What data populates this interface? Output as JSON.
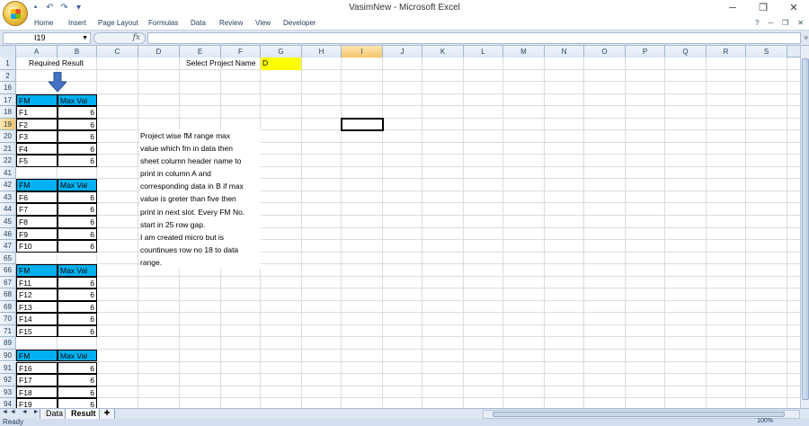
{
  "window": {
    "title": "VasimNew - Microsoft Excel"
  },
  "ribbon": {
    "tabs": [
      "Home",
      "Insert",
      "Page Layout",
      "Formulas",
      "Data",
      "Review",
      "View",
      "Developer"
    ]
  },
  "formula_bar": {
    "name_box": "I19",
    "fx": "fx",
    "content": ""
  },
  "columns": [
    "A",
    "B",
    "C",
    "D",
    "E",
    "F",
    "G",
    "H",
    "I",
    "J",
    "K",
    "L",
    "M",
    "N",
    "O",
    "P",
    "Q",
    "R",
    "S"
  ],
  "selected_column": "I",
  "rows": [
    "1",
    "2",
    "16",
    "17",
    "18",
    "19",
    "20",
    "21",
    "22",
    "41",
    "42",
    "43",
    "44",
    "45",
    "46",
    "47",
    "65",
    "66",
    "67",
    "68",
    "69",
    "70",
    "71",
    "89",
    "90",
    "91",
    "92",
    "93",
    "94"
  ],
  "selected_row": "19",
  "cells": {
    "a1": "Required Result",
    "e1": "Select Project Name",
    "g1": "D"
  },
  "tables": [
    {
      "header": [
        "FM",
        "Max Val"
      ],
      "rows": [
        [
          "F1",
          "6"
        ],
        [
          "F2",
          "6"
        ],
        [
          "F3",
          "6"
        ],
        [
          "F4",
          "6"
        ],
        [
          "F5",
          "6"
        ]
      ]
    },
    {
      "header": [
        "FM",
        "Max Val"
      ],
      "rows": [
        [
          "F6",
          "6"
        ],
        [
          "F7",
          "6"
        ],
        [
          "F8",
          "6"
        ],
        [
          "F9",
          "6"
        ],
        [
          "F10",
          "6"
        ]
      ]
    },
    {
      "header": [
        "FM",
        "Max Val"
      ],
      "rows": [
        [
          "F11",
          "6"
        ],
        [
          "F12",
          "6"
        ],
        [
          "F13",
          "6"
        ],
        [
          "F14",
          "6"
        ],
        [
          "F15",
          "6"
        ]
      ]
    },
    {
      "header": [
        "FM",
        "Max Val"
      ],
      "rows": [
        [
          "F16",
          "6"
        ],
        [
          "F17",
          "6"
        ],
        [
          "F18",
          "6"
        ],
        [
          "F19",
          "6"
        ]
      ]
    }
  ],
  "note_lines": [
    "Project wise fM range max",
    "value which fm in data then",
    "sheet column header name to",
    "print in column A and",
    "corresponding data in B if max",
    "value is greter than five then",
    "print in next slot. Every FM No.",
    "start in 25 row gap.",
    "I am created micro but is",
    "countinues row no 18 to data",
    "range."
  ],
  "sheets": [
    "Data",
    "Result"
  ],
  "active_sheet": "Result",
  "status": {
    "text": "Ready",
    "zoom": "100%"
  },
  "colors": {
    "header_fill": "#00b0f0",
    "yellow_fill": "#ffff00",
    "arrow": "#4472c4"
  }
}
